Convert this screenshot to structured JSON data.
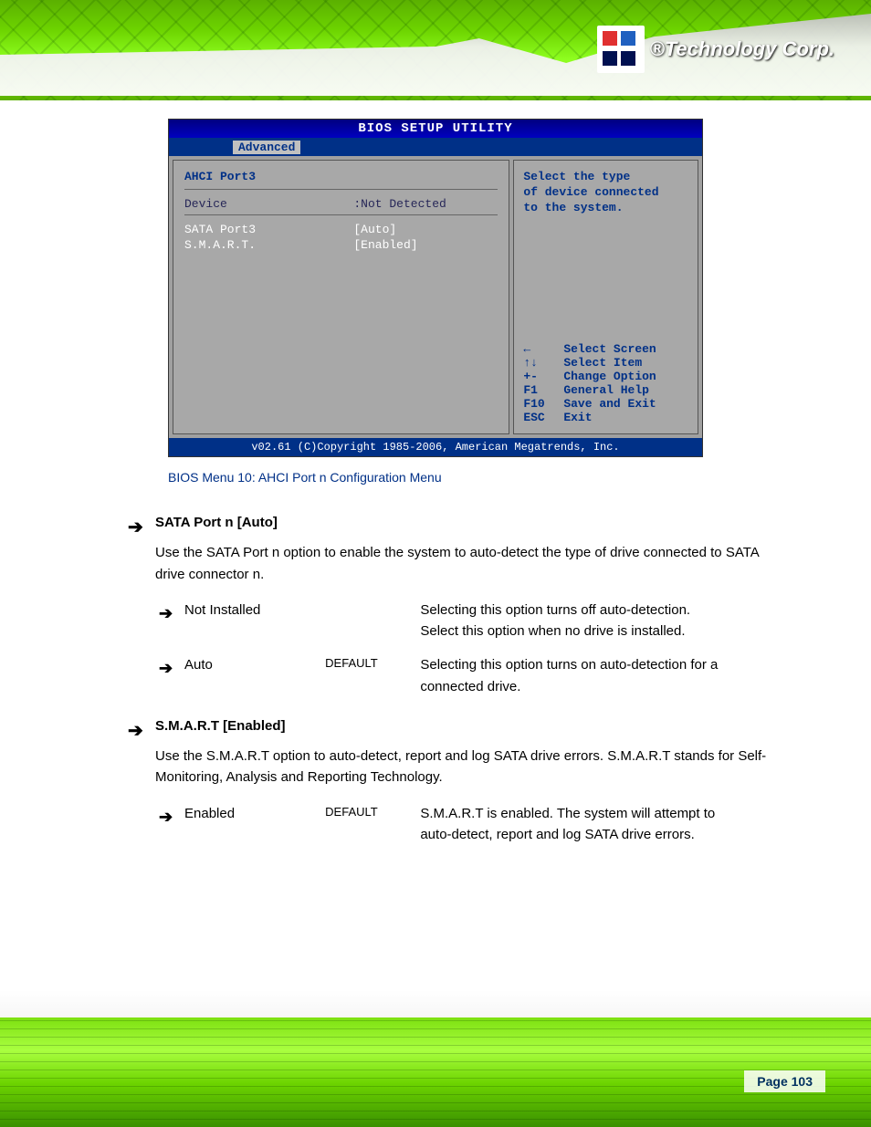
{
  "brand": {
    "name": "Technology Corp.",
    "reg": "®"
  },
  "bios": {
    "title": "BIOS SETUP UTILITY",
    "tab": "Advanced",
    "section": "AHCI Port3",
    "device_label": "Device",
    "device_value": ":Not Detected",
    "rows": [
      {
        "label": "SATA Port3",
        "value": "[Auto]"
      },
      {
        "label": "S.M.A.R.T.",
        "value": "[Enabled]"
      }
    ],
    "help_lines": [
      "Select the type",
      "of device connected",
      "to the system."
    ],
    "keys": [
      {
        "k": "←",
        "d": "Select Screen"
      },
      {
        "k": "↑↓",
        "d": "Select Item"
      },
      {
        "k": "+-",
        "d": "Change Option"
      },
      {
        "k": "F1",
        "d": "General Help"
      },
      {
        "k": "F10",
        "d": "Save and Exit"
      },
      {
        "k": "ESC",
        "d": "Exit"
      }
    ],
    "footer": "v02.61 (C)Copyright 1985-2006, American Megatrends, Inc."
  },
  "caption": "BIOS Menu 10: AHCI Port n Configuration Menu",
  "sections": [
    {
      "title": "SATA Port n [Auto]",
      "desc": "Use the SATA Port n option to enable the system to auto-detect the type of drive connected to SATA drive connector n.",
      "options": [
        {
          "name": "Not Installed",
          "def": "",
          "desc": "Selecting this option turns off auto-detection. Select this option when no drive is installed."
        },
        {
          "name": "Auto",
          "def": "DEFAULT",
          "desc": "Selecting this option turns on auto-detection for a connected drive."
        }
      ]
    },
    {
      "title": "S.M.A.R.T [Enabled]",
      "desc": "Use the S.M.A.R.T option to auto-detect, report and log SATA drive errors. S.M.A.R.T stands for Self-Monitoring, Analysis and Reporting Technology.",
      "options": [
        {
          "name": "Enabled",
          "def": "DEFAULT",
          "desc": "S.M.A.R.T is enabled. The system will attempt to auto-detect, report and log SATA drive errors."
        }
      ]
    }
  ],
  "page_label": "Page 103"
}
